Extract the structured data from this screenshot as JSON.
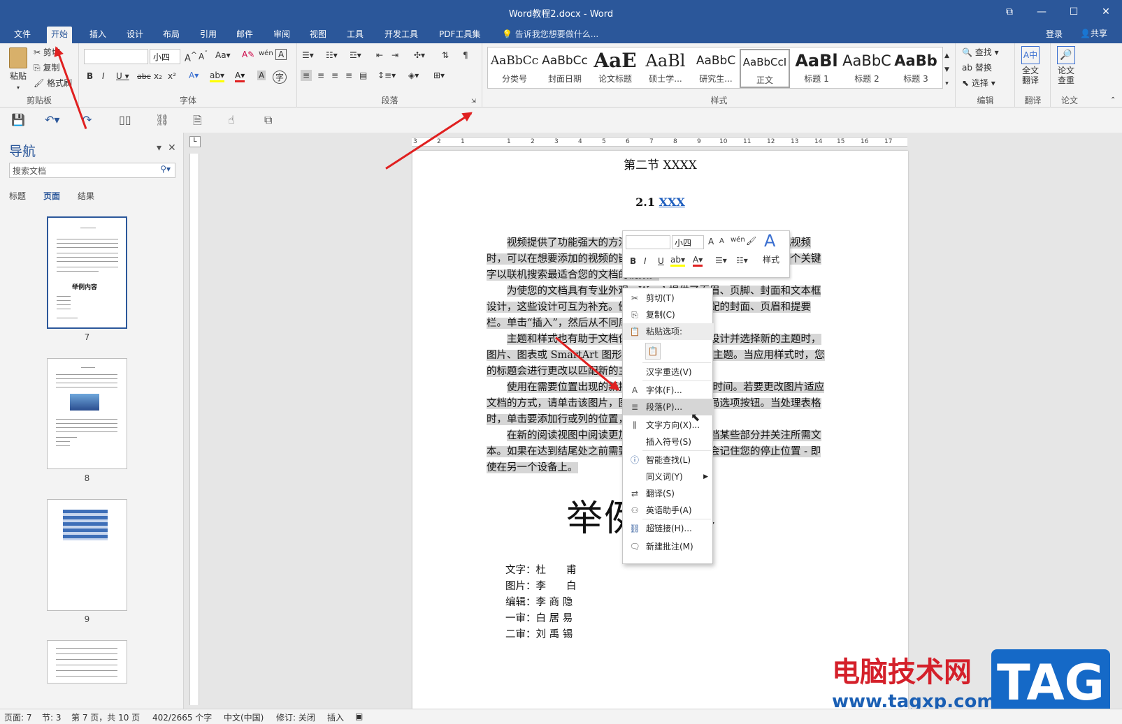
{
  "window": {
    "title": "Word教程2.docx - Word"
  },
  "window_controls": {
    "restore": "⧉",
    "minimize": "—",
    "maximize": "☐",
    "close": "✕"
  },
  "tabs": [
    "文件",
    "开始",
    "插入",
    "设计",
    "布局",
    "引用",
    "邮件",
    "审阅",
    "视图",
    "工具",
    "开发工具",
    "PDF工具集"
  ],
  "active_tab": "开始",
  "tellme": "告诉我您想要做什么...",
  "account": {
    "login": "登录",
    "share": "共享"
  },
  "clipboard": {
    "paste": "粘贴",
    "cut": "剪切",
    "copy": "复制",
    "format_painter": "格式刷",
    "label": "剪贴板"
  },
  "font": {
    "font_name": "",
    "font_size": "小四",
    "label": "字体"
  },
  "paragraph": {
    "label": "段落"
  },
  "styles": {
    "label": "样式",
    "items": [
      {
        "preview": "AaBbCc",
        "name": "分类号"
      },
      {
        "preview": "AaBbCc",
        "name": "封面日期"
      },
      {
        "preview": "AaE",
        "name": "论文标题"
      },
      {
        "preview": "AaBl",
        "name": "硕士学..."
      },
      {
        "preview": "AaBbC",
        "name": "研究生..."
      },
      {
        "preview": "AaBbCcI",
        "name": "正文"
      },
      {
        "preview": "AaBl",
        "name": "标题 1"
      },
      {
        "preview": "AaBbC",
        "name": "标题 2"
      },
      {
        "preview": "AaBb",
        "name": "标题 3"
      }
    ]
  },
  "editing": {
    "find": "查找",
    "replace": "替换",
    "select": "选择",
    "label": "编辑"
  },
  "translate": {
    "full": "全文\n翻译",
    "label": "翻译"
  },
  "paper": {
    "check": "论文\n查重",
    "label": "论文"
  },
  "nav": {
    "title": "导航",
    "search_placeholder": "搜索文档",
    "tabs": [
      "标题",
      "页面",
      "结果"
    ],
    "active_tab": "页面",
    "pages": [
      "7",
      "8",
      "9"
    ]
  },
  "ruler": {
    "h_marks": [
      "3",
      "2",
      "1",
      "1",
      "2",
      "3",
      "4",
      "5",
      "6",
      "7",
      "8",
      "9",
      "10",
      "11",
      "12",
      "13",
      "14",
      "15",
      "16",
      "17"
    ]
  },
  "document": {
    "heading1": "第二节 XXXX",
    "heading2_num": "2.1 ",
    "heading2_link": "XXX",
    "paragraphs": [
      "视频提供了功能强大的方法帮助您证明您的观点。当您单击联机视频时，可以在想要添加的视频的嵌入代码中进行粘贴。您也可以键入一个关键字以联机搜索最适合您的文档的视频。",
      "为使您的文档具有专业外观，Word 提供了页眉、页脚、封面和文本框设计，这些设计可互为补充。例如，您可以添加匹配的封面、页眉和提要栏。单击“插入”，然后从不同库中选择所需元素。",
      "主题和样式也有助于文档保持协调。当您单击设计并选择新的主题时，图片、图表或 SmartArt 图形将会更改以匹配新的主题。当应用样式时，您的标题会进行更改以匹配新的主题。",
      "使用在需要位置出现的新按钮在 Word 中保存时间。若要更改图片适应文档的方式，请单击该图片，图片旁边将会显示布局选项按钮。当处理表格时，单击要添加行或列的位置，然后单击加号。",
      "在新的阅读视图中阅读更加容易。可以折叠文档某些部分并关注所需文本。如果在达到结尾处之前需要停止读取，Word 会记住您的停止位置 - 即使在另一个设备上。"
    ],
    "big_title": "举例内容",
    "credits": [
      {
        "role": "文字：",
        "name": "杜　　甫"
      },
      {
        "role": "图片：",
        "name": "李　　白"
      },
      {
        "role": "编辑：",
        "name": "李 商 隐"
      },
      {
        "role": "一审：",
        "name": "白 居 易"
      },
      {
        "role": "二审：",
        "name": "刘 禹 锡"
      }
    ]
  },
  "mini_toolbar": {
    "font_name": "",
    "font_size": "小四",
    "styles": "样式"
  },
  "context_menu": {
    "items": [
      {
        "label": "剪切(T)",
        "icon": "scissors-icon"
      },
      {
        "label": "复制(C)",
        "icon": "copy-icon"
      },
      {
        "label": "粘贴选项:",
        "icon": "paste-icon"
      },
      {
        "label": "汉字重选(V)",
        "icon": ""
      },
      {
        "label": "字体(F)...",
        "icon": "font-icon"
      },
      {
        "label": "段落(P)...",
        "icon": "paragraph-icon"
      },
      {
        "label": "文字方向(X)...",
        "icon": "text-direction-icon"
      },
      {
        "label": "插入符号(S)",
        "icon": ""
      },
      {
        "label": "智能查找(L)",
        "icon": "smart-lookup-icon"
      },
      {
        "label": "同义词(Y)",
        "icon": ""
      },
      {
        "label": "翻译(S)",
        "icon": "translate-icon"
      },
      {
        "label": "英语助手(A)",
        "icon": "english-assistant-icon"
      },
      {
        "label": "超链接(H)...",
        "icon": "hyperlink-icon"
      },
      {
        "label": "新建批注(M)",
        "icon": "comment-icon"
      }
    ],
    "hovered": "段落(P)..."
  },
  "statusbar": {
    "page": "页面: 7",
    "section": "节: 3",
    "pages": "第 7 页，共 10 页",
    "words": "402/2665 个字",
    "language": "中文(中国)",
    "track": "修订: 关闭",
    "mode": "插入"
  },
  "watermark": {
    "cn": "电脑技术网",
    "url": "www.tagxp.com",
    "tag": "TAG"
  },
  "colors": {
    "brand": "#2b579a",
    "arrow": "#e02020",
    "highlight": "#d6d6d6",
    "link": "#1f5fbf"
  }
}
